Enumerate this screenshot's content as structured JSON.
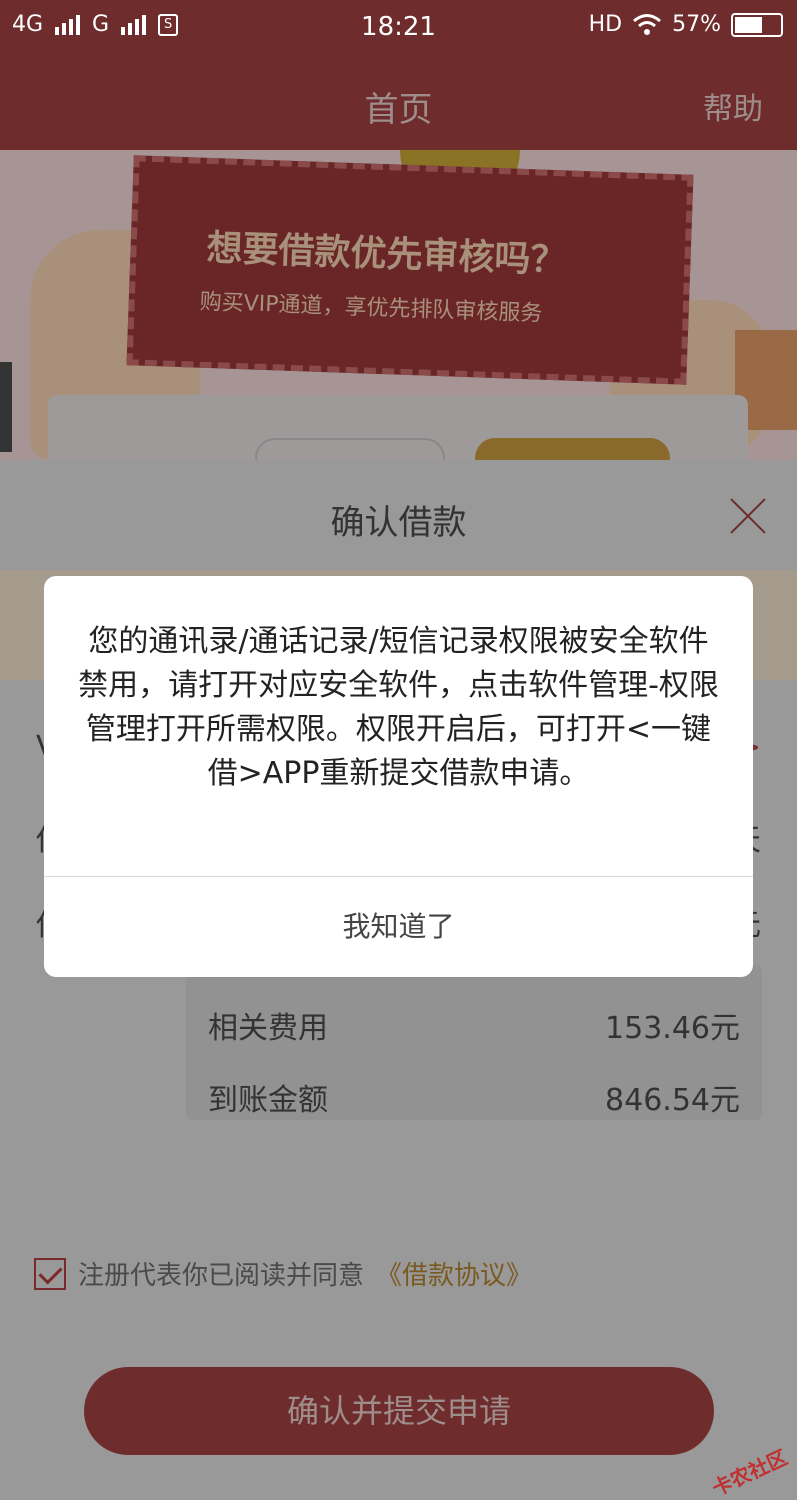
{
  "status_bar": {
    "network1": "4G",
    "network2": "G",
    "time": "18:21",
    "hd": "HD",
    "battery": "57%"
  },
  "header": {
    "title": "首页",
    "help": "帮助"
  },
  "banner": {
    "headline": "想要借款优先审核吗？",
    "subline": "购买VIP通道，享优先排队审核服务"
  },
  "sheet": {
    "title": "确认借款",
    "rows": [
      {
        "left": "V",
        "right": ">"
      },
      {
        "left": "借",
        "right": "天"
      },
      {
        "left": "借",
        "right": "元"
      }
    ],
    "fees": [
      {
        "label": "相关费用",
        "value": "153.46元"
      },
      {
        "label": "到账金额",
        "value": "846.54元"
      }
    ],
    "agree_text": "注册代表你已阅读并同意",
    "agree_link": "《借款协议》",
    "submit": "确认并提交申请"
  },
  "dialog": {
    "message": "您的通讯录/通话记录/短信记录权限被安全软件禁用，请打开对应安全软件，点击软件管理-权限管理打开所需权限。权限开启后，可打开<一键借>APP重新提交借款申请。",
    "button": "我知道了"
  },
  "watermark": "卡农社区",
  "colors": {
    "brand": "#d9534f",
    "overlay_header": "#6e2d2c",
    "dialog_bg": "#ffffff"
  }
}
